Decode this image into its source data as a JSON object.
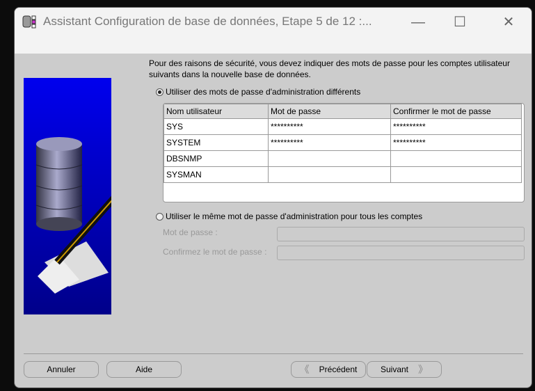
{
  "window": {
    "title": "Assistant Configuration de base de données, Etape 5 de 12 :...",
    "minimize_label": "—",
    "maximize_label": "☐",
    "close_label": "✕"
  },
  "intro": "Pour des raisons de sécurité, vous devez indiquer des mots de passe pour les comptes utilisateur suivants dans la nouvelle base de données.",
  "option_different": {
    "label": "Utiliser des mots de passe d'administration différents",
    "selected": true
  },
  "table": {
    "headers": [
      "Nom utilisateur",
      "Mot de passe",
      "Confirmer le mot de passe"
    ],
    "rows": [
      [
        "SYS",
        "**********",
        "**********"
      ],
      [
        "SYSTEM",
        "**********",
        "**********"
      ],
      [
        "DBSNMP",
        "",
        ""
      ],
      [
        "SYSMAN",
        "",
        ""
      ]
    ]
  },
  "option_same": {
    "label": "Utiliser le même mot de passe d'administration pour tous les comptes",
    "selected": false,
    "password_label": "Mot de passe :",
    "confirm_label": "Confirmez le mot de passe :",
    "password_value": "",
    "confirm_value": ""
  },
  "buttons": {
    "cancel": "Annuler",
    "help": "Aide",
    "back": "Précédent",
    "next": "Suivant"
  }
}
